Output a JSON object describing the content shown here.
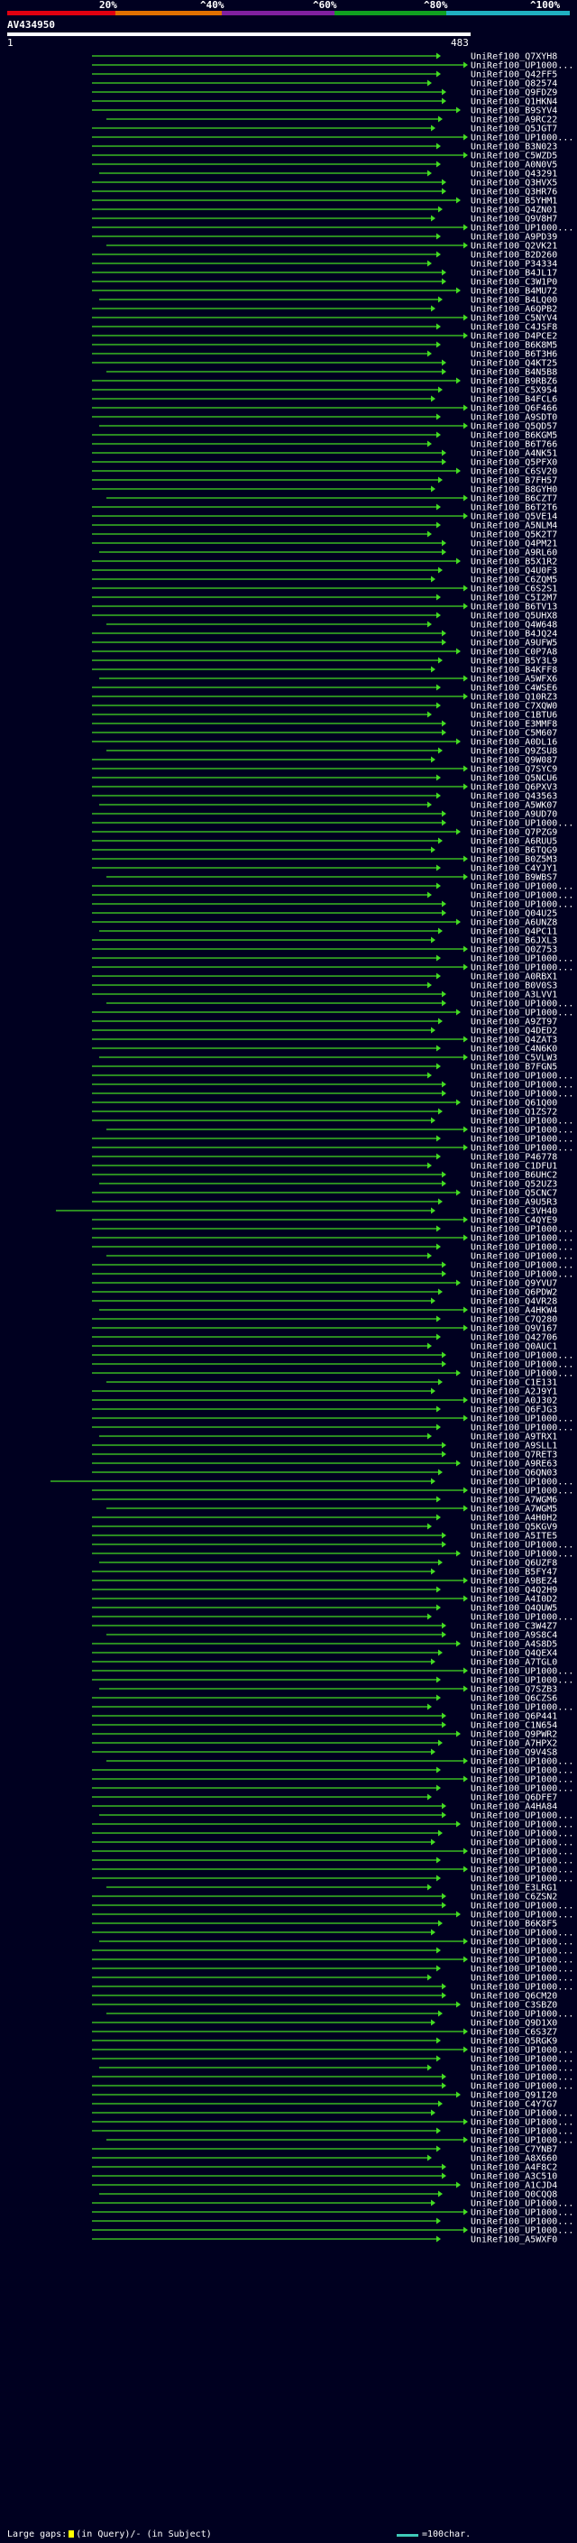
{
  "scale": {
    "ticks": [
      "20%",
      "^40%",
      "^60%",
      "^80%",
      "^100%"
    ],
    "band_colors": [
      "#e00010",
      "#e07000",
      "#8020a0",
      "#10a020",
      "#20b0c0"
    ]
  },
  "query": {
    "id": "AV434950",
    "start": "1",
    "end": "483"
  },
  "hits": {
    "color": "#44dd22",
    "labels": [
      "UniRef100_Q7XYH8",
      "UniRef100_UP1000...",
      "UniRef100_Q42FF5",
      "UniRef100_Q82574",
      "UniRef100_Q9FDZ9",
      "UniRef100_Q1HKN4",
      "UniRef100_B9SYV4",
      "UniRef100_A9RC22",
      "UniRef100_Q5JGT7",
      "UniRef100_UP1000...",
      "UniRef100_B3N023",
      "UniRef100_C5WZD5",
      "UniRef100_A0N0V5",
      "UniRef100_Q43291",
      "UniRef100_Q3HVX5",
      "UniRef100_Q3HR76",
      "UniRef100_B5YHM1",
      "UniRef100_Q4ZN01",
      "UniRef100_Q9V8H7",
      "UniRef100_UP1000...",
      "UniRef100_A9PD39",
      "UniRef100_Q2VK21",
      "UniRef100_B2D260",
      "UniRef100_P34334",
      "UniRef100_B4JL17",
      "UniRef100_C3W1P0",
      "UniRef100_B4MU72",
      "UniRef100_B4LQ00",
      "UniRef100_A6QPB2",
      "UniRef100_C5NYV4",
      "UniRef100_C4JSF8",
      "UniRef100_D4PCE2",
      "UniRef100_B6K8M5",
      "UniRef100_B6T3H6",
      "UniRef100_Q4KT25",
      "UniRef100_B4N5B8",
      "UniRef100_B9RBZ6",
      "UniRef100_C5X954",
      "UniRef100_B4FCL6",
      "UniRef100_Q6F466",
      "UniRef100_A9SDT0",
      "UniRef100_Q5QD57",
      "UniRef100_B6KGM5",
      "UniRef100_B6T766",
      "UniRef100_A4NK51",
      "UniRef100_Q5PFX0",
      "UniRef100_C6SV20",
      "UniRef100_B7FH57",
      "UniRef100_B8GYH0",
      "UniRef100_B6CZT7",
      "UniRef100_B6T2T6",
      "UniRef100_Q5VE14",
      "UniRef100_A5NLM4",
      "UniRef100_Q5K2T7",
      "UniRef100_Q4PM21",
      "UniRef100_A9RL60",
      "UniRef100_B5X1R2",
      "UniRef100_Q4U0F3",
      "UniRef100_C6ZQM5",
      "UniRef100_C6S2S1",
      "UniRef100_C5I2M7",
      "UniRef100_B6TV13",
      "UniRef100_Q5UHX8",
      "UniRef100_Q4W648",
      "UniRef100_B4JQ24",
      "UniRef100_A9UFW5",
      "UniRef100_C0P7A8",
      "UniRef100_B5Y3L9",
      "UniRef100_B4KFF8",
      "UniRef100_A5WFX6",
      "UniRef100_C4WSE6",
      "UniRef100_Q10RZ3",
      "UniRef100_C7XQW0",
      "UniRef100_C1BTU6",
      "UniRef100_E3MMF8",
      "UniRef100_C5M607",
      "UniRef100_A0DL16",
      "UniRef100_Q9ZSU8",
      "UniRef100_Q9W087",
      "UniRef100_Q7SYC9",
      "UniRef100_Q5NCU6",
      "UniRef100_Q6PXV3",
      "UniRef100_Q43563",
      "UniRef100_A5WK07",
      "UniRef100_A9UD70",
      "UniRef100_UP1000...",
      "UniRef100_Q7PZG9",
      "UniRef100_A6RUU5",
      "UniRef100_B6TQG9",
      "UniRef100_B0Z5M3",
      "UniRef100_C4YJY1",
      "UniRef100_B9WBS7",
      "UniRef100_UP1000...",
      "UniRef100_UP1000...",
      "UniRef100_UP1000...",
      "UniRef100_Q04U25",
      "UniRef100_A6UNZ8",
      "UniRef100_Q4PC11",
      "UniRef100_B6JXL3",
      "UniRef100_Q0Z753",
      "UniRef100_UP1000...",
      "UniRef100_UP1000...",
      "UniRef100_A0RBX1",
      "UniRef100_B0V0S3",
      "UniRef100_A3LVV1",
      "UniRef100_UP1000...",
      "UniRef100_UP1000...",
      "UniRef100_A9ZT97",
      "UniRef100_Q4DED2",
      "UniRef100_Q4ZAT3",
      "UniRef100_C4N6K0",
      "UniRef100_C5VLW3",
      "UniRef100_B7FGN5",
      "UniRef100_UP1000...",
      "UniRef100_UP1000...",
      "UniRef100_UP1000...",
      "UniRef100_Q61Q00",
      "UniRef100_Q1ZS72",
      "UniRef100_UP1000...",
      "UniRef100_UP1000...",
      "UniRef100_UP1000...",
      "UniRef100_UP1000...",
      "UniRef100_P46778",
      "UniRef100_C1DFU1",
      "UniRef100_B6UHC2",
      "UniRef100_Q52UZ3",
      "UniRef100_Q5CNC7",
      "UniRef100_A9U5R3",
      "UniRef100_C3VH40",
      "UniRef100_C4QYE9",
      "UniRef100_UP1000...",
      "UniRef100_UP1000...",
      "UniRef100_UP1000...",
      "UniRef100_UP1000...",
      "UniRef100_UP1000...",
      "UniRef100_UP1000...",
      "UniRef100_Q9YVU7",
      "UniRef100_Q6PDW2",
      "UniRef100_Q4VR28",
      "UniRef100_A4HKW4",
      "UniRef100_C7Q280",
      "UniRef100_Q9V167",
      "UniRef100_Q42706",
      "UniRef100_Q0AUC1",
      "UniRef100_UP1000...",
      "UniRef100_UP1000...",
      "UniRef100_UP1000...",
      "UniRef100_C1E131",
      "UniRef100_A2J9Y1",
      "UniRef100_A0J302",
      "UniRef100_Q6FJG3",
      "UniRef100_UP1000...",
      "UniRef100_UP1000...",
      "UniRef100_A9TRX1",
      "UniRef100_A9SLL1",
      "UniRef100_Q7RET3",
      "UniRef100_A9RE63",
      "UniRef100_Q6QN03",
      "UniRef100_UP1000...",
      "UniRef100_UP1000...",
      "UniRef100_A7WGM6",
      "UniRef100_A7WGM5",
      "UniRef100_A4H0H2",
      "UniRef100_Q5KGV9",
      "UniRef100_A5ITE5",
      "UniRef100_UP1000...",
      "UniRef100_UP1000...",
      "UniRef100_Q6UZF8",
      "UniRef100_B5FY47",
      "UniRef100_A9BEZ4",
      "UniRef100_Q4Q2H9",
      "UniRef100_A4I0D2",
      "UniRef100_Q4QUW5",
      "UniRef100_UP1000...",
      "UniRef100_C3W4Z7",
      "UniRef100_A9S8C4",
      "UniRef100_A4S8D5",
      "UniRef100_Q4QEX4",
      "UniRef100_A7TGL0",
      "UniRef100_UP1000...",
      "UniRef100_UP1000...",
      "UniRef100_Q7SZB3",
      "UniRef100_Q6CZS6",
      "UniRef100_UP1000...",
      "UniRef100_Q6P441",
      "UniRef100_C1N654",
      "UniRef100_Q9PWR2",
      "UniRef100_A7HPX2",
      "UniRef100_Q9V4S8",
      "UniRef100_UP1000...",
      "UniRef100_UP1000...",
      "UniRef100_UP1000...",
      "UniRef100_UP1000...",
      "UniRef100_Q6DFE7",
      "UniRef100_A4HA84",
      "UniRef100_UP1000...",
      "UniRef100_UP1000...",
      "UniRef100_UP1000...",
      "UniRef100_UP1000...",
      "UniRef100_UP1000...",
      "UniRef100_UP1000...",
      "UniRef100_UP1000...",
      "UniRef100_UP1000...",
      "UniRef100_E3LRG1",
      "UniRef100_C6ZSN2",
      "UniRef100_UP1000...",
      "UniRef100_UP1000...",
      "UniRef100_B6K8F5",
      "UniRef100_UP1000...",
      "UniRef100_UP1000...",
      "UniRef100_UP1000...",
      "UniRef100_UP1000...",
      "UniRef100_UP1000...",
      "UniRef100_UP1000...",
      "UniRef100_UP1000...",
      "UniRef100_Q6CM20",
      "UniRef100_C3SBZ0",
      "UniRef100_UP1000...",
      "UniRef100_Q9D1X0",
      "UniRef100_C6S3Z7",
      "UniRef100_Q5RGK9",
      "UniRef100_UP1000...",
      "UniRef100_UP1000...",
      "UniRef100_UP1000...",
      "UniRef100_UP1000...",
      "UniRef100_UP1000...",
      "UniRef100_Q91I20",
      "UniRef100_C4Y7G7",
      "UniRef100_UP1000...",
      "UniRef100_UP1000...",
      "UniRef100_UP1000...",
      "UniRef100_UP1000...",
      "UniRef100_C7YNB7",
      "UniRef100_A8X660",
      "UniRef100_A4F8C2",
      "UniRef100_A3C510",
      "UniRef100_A1CJD4",
      "UniRef100_Q0CQQ8",
      "UniRef100_UP1000...",
      "UniRef100_UP1000...",
      "UniRef100_UP1000...",
      "UniRef100_UP1000...",
      "UniRef100_A5WXF0"
    ]
  },
  "legend": {
    "large_gaps": "Large gaps:",
    "in_query": "(in Query)/- (in Subject)",
    "scale_text": "=100char."
  }
}
